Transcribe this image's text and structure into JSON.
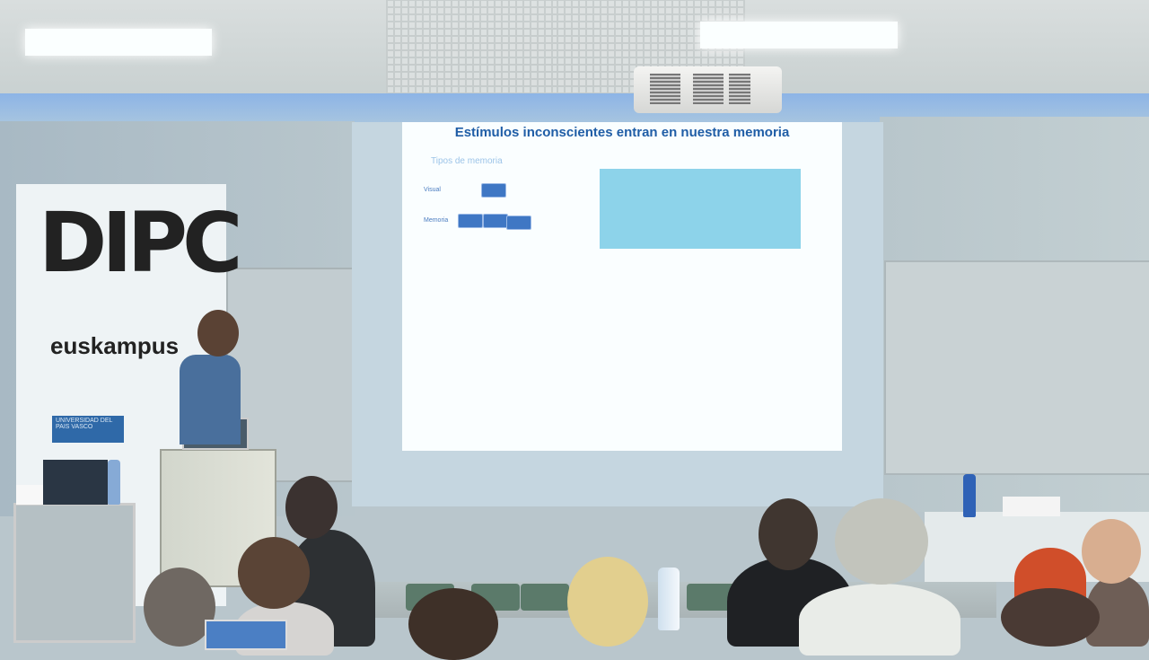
{
  "slide": {
    "title": "Estímulos inconscientes entran en nuestra memoria",
    "subtitle": "Tipos de memoria",
    "row_labels": [
      "Visual",
      "Memoria"
    ],
    "box_color": "#8dd3ea",
    "title_color": "#1f5da6"
  },
  "banner": {
    "logo": "DIPC",
    "text": "euskampus",
    "badge": "UNIVERSIDAD DEL PAIS VASCO"
  },
  "scene": {
    "description_colors": {
      "wall": "#b9c6cc",
      "screen": "#c5d6e0"
    }
  }
}
